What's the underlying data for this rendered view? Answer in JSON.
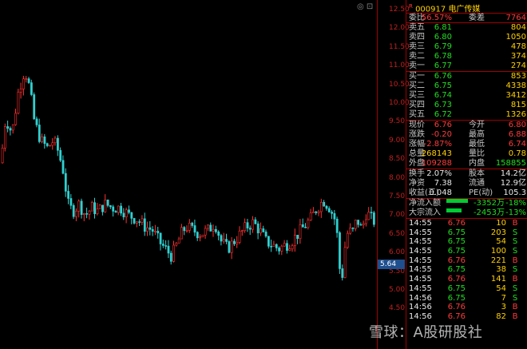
{
  "app": {
    "top_icons": "◎ ⊡",
    "watermark": "雪球：A股研股社"
  },
  "axis": {
    "ticks": [
      "12.50",
      "12.00",
      "11.50",
      "11.00",
      "10.50",
      "10.00",
      "9.50",
      "9.00",
      "8.50",
      "8.00",
      "7.50",
      "7.00",
      "6.50",
      "6.00",
      "5.50",
      "5.00",
      "4.50"
    ],
    "current_price": "5.64"
  },
  "stock": {
    "r_mark": "R",
    "code": "000917",
    "name": "电广传媒"
  },
  "summary": {
    "wb_label": "委比",
    "wb_value": "56.57%",
    "wc_label": "委差",
    "wc_value": "7764"
  },
  "asks": [
    {
      "label": "卖五",
      "price": "6.81",
      "vol": "804"
    },
    {
      "label": "卖四",
      "price": "6.80",
      "vol": "1050"
    },
    {
      "label": "卖三",
      "price": "6.79",
      "vol": "478"
    },
    {
      "label": "卖二",
      "price": "6.78",
      "vol": "374"
    },
    {
      "label": "卖一",
      "price": "6.77",
      "vol": "274"
    }
  ],
  "bids": [
    {
      "label": "买一",
      "price": "6.76",
      "vol": "853"
    },
    {
      "label": "买二",
      "price": "6.75",
      "vol": "4338"
    },
    {
      "label": "买三",
      "price": "6.74",
      "vol": "3412"
    },
    {
      "label": "买四",
      "price": "6.73",
      "vol": "815"
    },
    {
      "label": "买五",
      "price": "6.72",
      "vol": "1326"
    }
  ],
  "quote": [
    {
      "l1": "现价",
      "v1": "6.76",
      "c1": "red",
      "l2": "今开",
      "v2": "6.80",
      "c2": "red"
    },
    {
      "l1": "涨跌",
      "v1": "-0.20",
      "c1": "red",
      "l2": "最高",
      "v2": "6.88",
      "c2": "red"
    },
    {
      "l1": "涨幅",
      "v1": "-2.87%",
      "c1": "red",
      "l2": "最低",
      "v2": "6.74",
      "c2": "red"
    },
    {
      "l1": "总量",
      "v1": "268143",
      "c1": "yel",
      "l2": "量比",
      "v2": "0.78",
      "c2": "yel"
    },
    {
      "l1": "外盘",
      "v1": "109288",
      "c1": "red",
      "l2": "内盘",
      "v2": "158855",
      "c2": "grn"
    }
  ],
  "fund": [
    {
      "l1": "换手",
      "v1": "2.07%",
      "l2": "股本",
      "v2": "14.2亿"
    },
    {
      "l1": "净资",
      "v1": "7.38",
      "l2": "流通",
      "v2": "12.9亿"
    },
    {
      "l1": "收益(三)",
      "v1": "0.048",
      "l2": "PE(动)",
      "v2": "105.3"
    }
  ],
  "flows": [
    {
      "label": "净流入额",
      "amount": "-3352万",
      "pct": "-18%",
      "bar": 0.85
    },
    {
      "label": "大宗流入",
      "amount": "-2453万",
      "pct": "-13%",
      "bar": 0.6
    }
  ],
  "ticks": [
    {
      "time": "14:55",
      "price": "6.76",
      "vol": "10",
      "side": "B"
    },
    {
      "time": "14:55",
      "price": "6.75",
      "vol": "203",
      "side": "S"
    },
    {
      "time": "14:55",
      "price": "6.75",
      "vol": "54",
      "side": "S"
    },
    {
      "time": "14:55",
      "price": "6.75",
      "vol": "100",
      "side": "S"
    },
    {
      "time": "14:55",
      "price": "6.76",
      "vol": "221",
      "side": "B"
    },
    {
      "time": "14:55",
      "price": "6.75",
      "vol": "38",
      "side": "S"
    },
    {
      "time": "14:55",
      "price": "6.76",
      "vol": "141",
      "side": "B"
    },
    {
      "time": "14:55",
      "price": "6.75",
      "vol": "54",
      "side": "S"
    },
    {
      "time": "14:56",
      "price": "6.75",
      "vol": "7",
      "side": "S"
    },
    {
      "time": "14:56",
      "price": "6.76",
      "vol": "3",
      "side": "B"
    },
    {
      "time": "14:56",
      "price": "6.76",
      "vol": "82",
      "side": "B"
    }
  ],
  "chart_data": {
    "type": "candlestick",
    "title": "",
    "ylim": [
      4.4,
      12.65
    ],
    "last_price": 5.64,
    "up_color": "#ff3030",
    "down_color": "#30d0d0",
    "path": [
      [
        0,
        8.4
      ],
      [
        6,
        9.6
      ],
      [
        14,
        9.2
      ],
      [
        22,
        10.3
      ],
      [
        30,
        10.9
      ],
      [
        36,
        10.4
      ],
      [
        42,
        9.5
      ],
      [
        50,
        9.0
      ],
      [
        58,
        8.8
      ],
      [
        66,
        9.0
      ],
      [
        72,
        8.7
      ],
      [
        78,
        8.2
      ],
      [
        84,
        7.3
      ],
      [
        90,
        7.1
      ],
      [
        98,
        7.3
      ],
      [
        106,
        7.0
      ],
      [
        114,
        7.2
      ],
      [
        122,
        7.1
      ],
      [
        130,
        7.3
      ],
      [
        140,
        7.2
      ],
      [
        150,
        7.2
      ],
      [
        160,
        7.0
      ],
      [
        170,
        6.9
      ],
      [
        180,
        6.7
      ],
      [
        190,
        6.6
      ],
      [
        198,
        6.3
      ],
      [
        206,
        6.1
      ],
      [
        214,
        5.9
      ],
      [
        220,
        6.2
      ],
      [
        226,
        6.5
      ],
      [
        232,
        6.7
      ],
      [
        240,
        6.6
      ],
      [
        250,
        6.5
      ],
      [
        260,
        6.6
      ],
      [
        268,
        6.8
      ],
      [
        276,
        6.3
      ],
      [
        284,
        6.1
      ],
      [
        292,
        6.3
      ],
      [
        300,
        6.5
      ],
      [
        308,
        6.7
      ],
      [
        316,
        6.8
      ],
      [
        324,
        6.6
      ],
      [
        332,
        6.3
      ],
      [
        340,
        6.2
      ],
      [
        348,
        6.1
      ],
      [
        356,
        6.2
      ],
      [
        364,
        6.3
      ],
      [
        372,
        6.5
      ],
      [
        380,
        6.7
      ],
      [
        388,
        6.9
      ],
      [
        396,
        7.2
      ],
      [
        404,
        7.4
      ],
      [
        412,
        7.2
      ],
      [
        420,
        6.8
      ],
      [
        424,
        5.6
      ],
      [
        428,
        5.4
      ],
      [
        432,
        6.4
      ],
      [
        436,
        6.6
      ],
      [
        440,
        6.5
      ],
      [
        446,
        6.9
      ],
      [
        452,
        6.6
      ],
      [
        458,
        7.1
      ],
      [
        464,
        6.9
      ],
      [
        470,
        6.8
      ]
    ]
  }
}
